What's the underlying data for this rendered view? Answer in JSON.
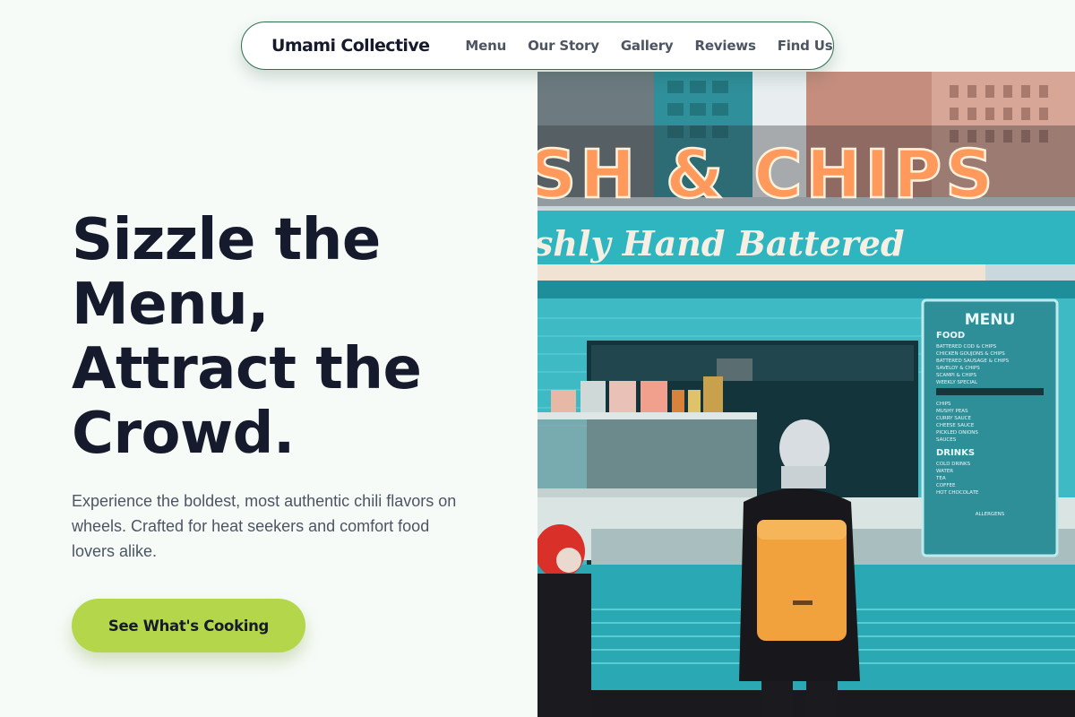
{
  "nav": {
    "brand": "Umami Collective",
    "links": [
      "Menu",
      "Our Story",
      "Gallery",
      "Reviews",
      "Find Us"
    ]
  },
  "hero": {
    "title_lines": [
      "Sizzle the",
      "Menu,",
      "Attract the",
      "Crowd."
    ],
    "subtitle": "Experience the boldest, most authentic chili flavors on wheels. Crafted for heat seekers and comfort food lovers alike.",
    "cta_label": "See What's Cooking"
  },
  "photo": {
    "sign_text": "SH & CHIPS",
    "banner_text": "shly Hand Battered",
    "menu_board": {
      "title": "MENU",
      "food_heading": "FOOD",
      "food_items": [
        "BATTERED COD & CHIPS",
        "CHICKEN GOUJONS & CHIPS",
        "BATTERED SAUSAGE & CHIPS",
        "SAVELOY & CHIPS",
        "SCAMPI & CHIPS",
        "WEEKLY SPECIAL"
      ],
      "side_items": [
        "CHIPS",
        "MUSHY PEAS",
        "CURRY SAUCE",
        "CHEESE SAUCE",
        "PICKLED ONIONS",
        "SAUCES"
      ],
      "drinks_heading": "DRINKS",
      "drink_items": [
        "COLD DRINKS",
        "WATER",
        "TEA",
        "COFFEE",
        "HOT CHOCOLATE"
      ],
      "footer": "ALLERGENS"
    }
  },
  "colors": {
    "background": "#f6fbf8",
    "nav_border": "#2f6f4f",
    "cta": "#b4d64a",
    "heading": "#151a2c",
    "body_text": "#4d5563",
    "truck_teal": "#2fb5bf",
    "sign_orange": "#ff9a5c",
    "backpack": "#f2a23c"
  }
}
